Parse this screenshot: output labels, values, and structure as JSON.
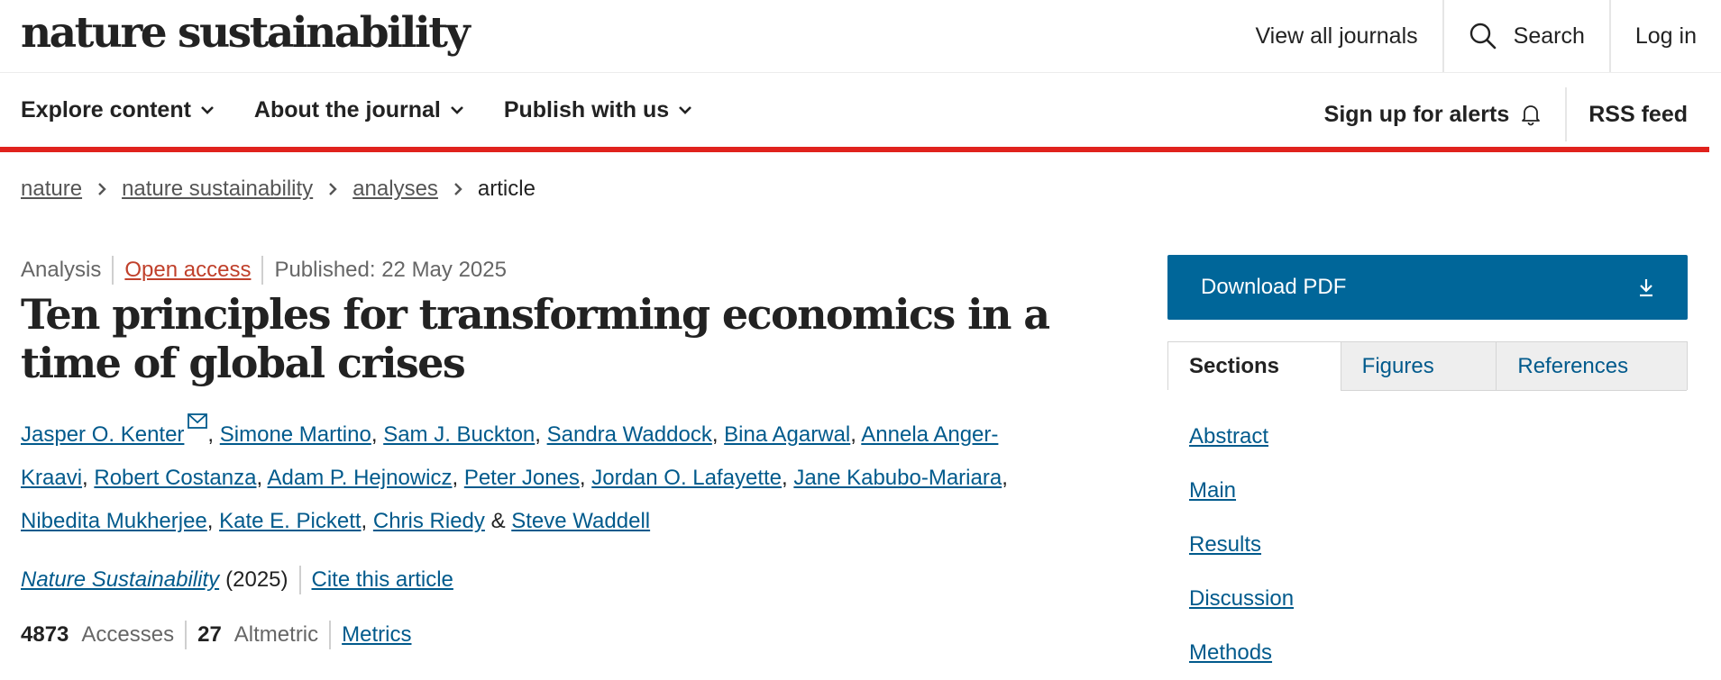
{
  "header": {
    "logo": "nature sustainability",
    "links": {
      "view_all": "View all journals",
      "search": "Search",
      "login": "Log in"
    }
  },
  "nav": {
    "items": [
      "Explore content",
      "About the journal",
      "Publish with us"
    ],
    "alerts": "Sign up for alerts",
    "rss": "RSS feed"
  },
  "breadcrumb": [
    "nature",
    "nature sustainability",
    "analyses",
    "article"
  ],
  "article": {
    "type": "Analysis",
    "access": "Open access",
    "published": "Published: 22 May 2025",
    "title": "Ten principles for transforming economics in a time of global crises",
    "authors": [
      "Jasper O. Kenter",
      "Simone Martino",
      "Sam J. Buckton",
      "Sandra Waddock",
      "Bina Agarwal",
      "Annela Anger-Kraavi",
      "Robert Costanza",
      "Adam P. Hejnowicz",
      "Peter Jones",
      "Jordan O. Lafayette",
      "Jane Kabubo-Mariara",
      "Nibedita Mukherjee",
      "Kate E. Pickett",
      "Chris Riedy",
      "Steve Waddell"
    ],
    "journal": "Nature Sustainability",
    "year": "(2025)",
    "cite": "Cite this article",
    "accesses_count": "4873",
    "accesses_label": "Accesses",
    "altmetric_count": "27",
    "altmetric_label": "Altmetric",
    "metrics_link": "Metrics"
  },
  "sidebar": {
    "download": "Download PDF",
    "tabs": [
      "Sections",
      "Figures",
      "References"
    ],
    "sections": [
      "Abstract",
      "Main",
      "Results",
      "Discussion",
      "Methods"
    ]
  },
  "colors": {
    "accent_red": "#e0221d",
    "link_blue": "#015a8c",
    "download_blue": "#006699",
    "open_access": "#c0402b"
  },
  "icons": [
    "search-icon",
    "chevron-down-icon",
    "bell-icon",
    "chevron-right-icon",
    "mail-icon",
    "download-icon"
  ]
}
